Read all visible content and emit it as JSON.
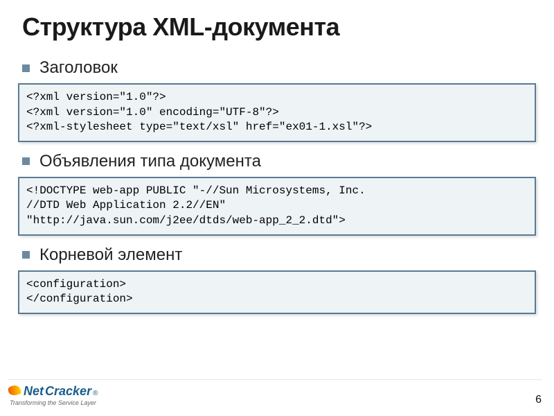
{
  "title": "Структура XML-документа",
  "sections": [
    {
      "label": "Заголовок",
      "code": "<?xml version=\"1.0\"?>\n<?xml version=\"1.0\" encoding=\"UTF-8\"?>\n<?xml-stylesheet type=\"text/xsl\" href=\"ex01-1.xsl\"?>"
    },
    {
      "label": "Объявления типа документа",
      "code": "<!DOCTYPE web-app PUBLIC \"-//Sun Microsystems, Inc.\n//DTD Web Application 2.2//EN\"\n\"http://java.sun.com/j2ee/dtds/web-app_2_2.dtd\">"
    },
    {
      "label": "Корневой элемент",
      "code": "<configuration>\n</configuration>"
    }
  ],
  "footer": {
    "logo_part1": "Net",
    "logo_part2": "Cracker",
    "registered": "®",
    "tagline": "Transforming the Service Layer",
    "page_number": "6"
  }
}
